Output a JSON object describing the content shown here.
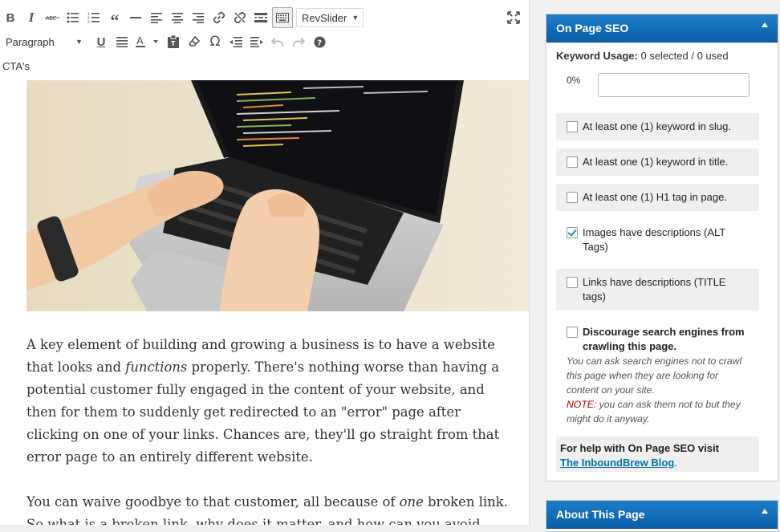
{
  "toolbar": {
    "row1_icons": [
      "bold-icon",
      "italic-icon",
      "strikethrough-icon",
      "bullet-list-icon",
      "numbered-list-icon",
      "blockquote-icon",
      "horizontal-rule-icon",
      "align-left-icon",
      "align-center-icon",
      "align-right-icon",
      "link-icon",
      "unlink-icon",
      "read-more-icon",
      "toolbar-toggle-icon"
    ],
    "revslider_label": "RevSlider",
    "row2": {
      "format_value": "Paragraph"
    },
    "cta_label": "CTA's"
  },
  "content": {
    "p1_a": "A key element of building and growing a business is to have a website that looks and ",
    "p1_em": "functions",
    "p1_b": " properly.  There's nothing worse than having a potential customer fully engaged in the content of your website, and then for them to suddenly get redirected to an \"error\" page after clicking on one of your links. Chances are, they'll go straight from that error page to an entirely different website.",
    "p2_a": "You can waive goodbye to that customer, all because of ",
    "p2_em": "one",
    "p2_b": " broken link. So what is a broken link, why does it matter, and how can you avoid"
  },
  "seo": {
    "title": "On Page SEO",
    "kw_label": "Keyword Usage:",
    "kw_value": " 0 selected / 0 used",
    "percent": "0%",
    "checks": [
      {
        "label": "At least one (1) keyword in slug.",
        "checked": false
      },
      {
        "label": "At least one (1) keyword in title.",
        "checked": false
      },
      {
        "label": "At least one (1) H1 tag in page.",
        "checked": false
      },
      {
        "label": "Images have descriptions (ALT Tags)",
        "checked": true
      },
      {
        "label": "Links have descriptions (TITLE tags)",
        "checked": false
      },
      {
        "label": "Discourage search engines from crawling this page.",
        "checked": false
      }
    ],
    "discourage_note": "You can ask search engines not to crawl this page when they are looking for content on your site.",
    "note_label": "NOTE:",
    "note_text": " you can ask them not to but they might do it anyway.",
    "help_text": "For help with On Page SEO visit",
    "help_link": "The InboundBrew Blog",
    "help_period": "."
  },
  "about": {
    "title": "About This Page"
  },
  "colors": {
    "header_blue": "#0a5ea6",
    "link_blue": "#0073aa",
    "note_red": "#aa0000"
  }
}
